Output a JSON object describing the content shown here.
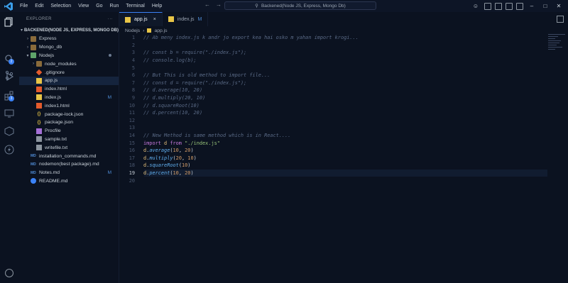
{
  "menu": [
    "File",
    "Edit",
    "Selection",
    "View",
    "Go",
    "Run",
    "Terminal",
    "Help"
  ],
  "command_center": "Backened(Node JS, Express, Mongo Db)",
  "activity_badges": {
    "source_control": "2",
    "extensions": "3"
  },
  "explorer": {
    "title": "EXPLORER",
    "more": "···",
    "root": "BACKENED(NODE JS, EXPRESS, MONGO DB)",
    "items": [
      {
        "label": "Express",
        "type": "folder",
        "depth": 1,
        "expanded": false
      },
      {
        "label": "Mongo_db",
        "type": "folder",
        "depth": 1,
        "expanded": false
      },
      {
        "label": "Nodejs",
        "type": "folder-open",
        "depth": 1,
        "expanded": true,
        "dot": true
      },
      {
        "label": "node_modules",
        "type": "folder",
        "depth": 2,
        "expanded": false
      },
      {
        "label": ".gitignore",
        "type": "git",
        "depth": 2
      },
      {
        "label": "app.js",
        "type": "js",
        "depth": 2,
        "selected": true
      },
      {
        "label": "index.html",
        "type": "html",
        "depth": 2
      },
      {
        "label": "index.js",
        "type": "js",
        "depth": 2,
        "status": "M"
      },
      {
        "label": "index1.html",
        "type": "html",
        "depth": 2
      },
      {
        "label": "package-lock.json",
        "type": "json",
        "depth": 2
      },
      {
        "label": "package.json",
        "type": "json",
        "depth": 2
      },
      {
        "label": "Procfile",
        "type": "proc",
        "depth": 2
      },
      {
        "label": "sample.txt",
        "type": "txt",
        "depth": 2
      },
      {
        "label": "writefile.txt",
        "type": "txt",
        "depth": 2
      },
      {
        "label": "installation_commands.md",
        "type": "md",
        "depth": 1
      },
      {
        "label": "nodemon(best package).md",
        "type": "md",
        "depth": 1
      },
      {
        "label": "Notes.md",
        "type": "md",
        "depth": 1,
        "status": "M"
      },
      {
        "label": "README.md",
        "type": "info",
        "depth": 1
      }
    ]
  },
  "tabs": [
    {
      "label": "app.js",
      "active": true,
      "close": "×"
    },
    {
      "label": "index.js",
      "active": false,
      "status": "M"
    }
  ],
  "breadcrumb": {
    "folder": "Nodejs",
    "separator": "›",
    "file": "app.js"
  },
  "current_line": 19,
  "code_lines": [
    [
      {
        "t": "// Ab meny index.js k andr jo export kea hai osko m yahan import krogi...",
        "c": "cm"
      }
    ],
    [],
    [
      {
        "t": "// const b = require(\"./index.js\");",
        "c": "cm"
      }
    ],
    [
      {
        "t": "// console.log(b);",
        "c": "cm"
      }
    ],
    [],
    [
      {
        "t": "// But This is old method to import file...",
        "c": "cm"
      }
    ],
    [
      {
        "t": "// const d = require(\"./index.js\");",
        "c": "cm"
      }
    ],
    [
      {
        "t": "// d.average(10, 20)",
        "c": "cm"
      }
    ],
    [
      {
        "t": "// d.multiply(20, 10)",
        "c": "cm"
      }
    ],
    [
      {
        "t": "// d.squareRoot(10)",
        "c": "cm"
      }
    ],
    [
      {
        "t": "// d.percent(10, 20)",
        "c": "cm"
      }
    ],
    [],
    [],
    [
      {
        "t": "// New Method is same method which is in React....",
        "c": "cm"
      }
    ],
    [
      {
        "t": "import",
        "c": "kw"
      },
      {
        "t": " d ",
        "c": "var"
      },
      {
        "t": "from",
        "c": "kw"
      },
      {
        "t": " ",
        "c": ""
      },
      {
        "t": "\"./index.js\"",
        "c": "str"
      }
    ],
    [
      {
        "t": "d",
        "c": "var"
      },
      {
        "t": ".",
        "c": ""
      },
      {
        "t": "average",
        "c": "id"
      },
      {
        "t": "(",
        "c": ""
      },
      {
        "t": "10",
        "c": "num"
      },
      {
        "t": ", ",
        "c": ""
      },
      {
        "t": "20",
        "c": "num"
      },
      {
        "t": ")",
        "c": ""
      }
    ],
    [
      {
        "t": "d",
        "c": "var"
      },
      {
        "t": ".",
        "c": ""
      },
      {
        "t": "multiply",
        "c": "id"
      },
      {
        "t": "(",
        "c": ""
      },
      {
        "t": "20",
        "c": "num"
      },
      {
        "t": ", ",
        "c": ""
      },
      {
        "t": "10",
        "c": "num"
      },
      {
        "t": ")",
        "c": ""
      }
    ],
    [
      {
        "t": "d",
        "c": "var"
      },
      {
        "t": ".",
        "c": ""
      },
      {
        "t": "squareRoot",
        "c": "id"
      },
      {
        "t": "(",
        "c": ""
      },
      {
        "t": "10",
        "c": "num"
      },
      {
        "t": ")",
        "c": ""
      }
    ],
    [
      {
        "t": "d",
        "c": "var"
      },
      {
        "t": ".",
        "c": ""
      },
      {
        "t": "percent",
        "c": "id"
      },
      {
        "t": "(",
        "c": ""
      },
      {
        "t": "10",
        "c": "num"
      },
      {
        "t": ", ",
        "c": ""
      },
      {
        "t": "20",
        "c": "num"
      },
      {
        "t": ")",
        "c": ""
      }
    ],
    []
  ]
}
